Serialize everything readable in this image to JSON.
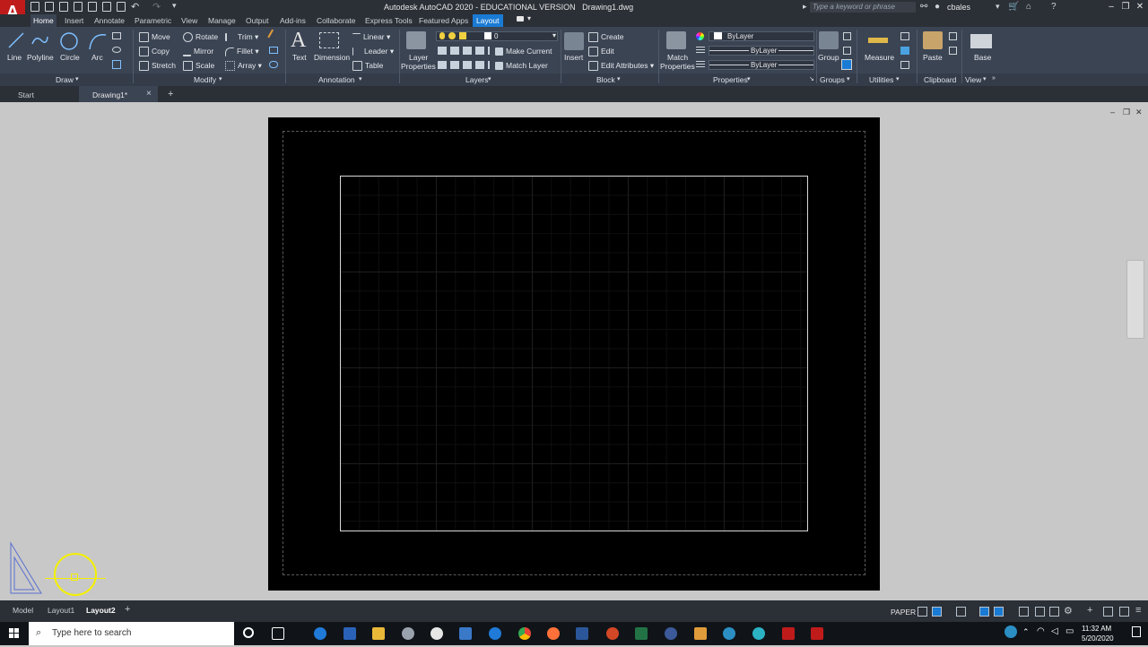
{
  "title_bar": {
    "app_title": "Autodesk AutoCAD 2020 - EDUCATIONAL VERSION",
    "file_name": "Drawing1.dwg",
    "search_placeholder": "Type a keyword or phrase",
    "user": "cbales",
    "logo_letter": "A"
  },
  "ribbon_tabs": [
    "Home",
    "Insert",
    "Annotate",
    "Parametric",
    "View",
    "Manage",
    "Output",
    "Add-ins",
    "Collaborate",
    "Express Tools",
    "Featured Apps",
    "Layout"
  ],
  "ribbon": {
    "draw": {
      "label": "Draw",
      "tools": [
        "Line",
        "Polyline",
        "Circle",
        "Arc"
      ]
    },
    "modify": {
      "label": "Modify",
      "tools": [
        "Move",
        "Rotate",
        "Trim",
        "Copy",
        "Mirror",
        "Fillet",
        "Stretch",
        "Scale",
        "Array"
      ]
    },
    "annotation": {
      "label": "Annotation",
      "tools": [
        "Text",
        "Dimension",
        "Linear",
        "Leader",
        "Table"
      ]
    },
    "layers": {
      "label": "Layers",
      "layer_properties_1": "Layer",
      "layer_properties_2": "Properties",
      "current_layer": "0",
      "make_current": "Make Current",
      "match_layer": "Match Layer"
    },
    "block": {
      "label": "Block",
      "insert": "Insert",
      "create": "Create",
      "edit": "Edit",
      "edit_attributes": "Edit Attributes"
    },
    "properties": {
      "label": "Properties",
      "match_1": "Match",
      "match_2": "Properties",
      "color": "ByLayer",
      "linetype": "ByLayer",
      "lineweight": "ByLayer"
    },
    "groups": {
      "label": "Groups",
      "group": "Group"
    },
    "utilities": {
      "label": "Utilities",
      "measure": "Measure"
    },
    "clipboard": {
      "label": "Clipboard",
      "paste": "Paste"
    },
    "view": {
      "label": "View",
      "base": "Base"
    }
  },
  "file_tabs": {
    "start": "Start",
    "drawing": "Drawing1*",
    "close": "×",
    "add": "+"
  },
  "layout_tabs": {
    "tabs": [
      "Model",
      "Layout1",
      "Layout2"
    ],
    "active": "Layout2",
    "add": "+"
  },
  "status": {
    "space": "PAPER"
  },
  "taskbar": {
    "search_placeholder": "Type here to search",
    "time": "11:32 AM",
    "date": "5/20/2020"
  },
  "colors": {
    "ribbon_bg": "#3b4453",
    "title_bg": "#2b2f36",
    "canvas_bg": "#c8c8c8",
    "paper": "#000000",
    "cursor": "#f4f000",
    "accent": "#1a7bd4"
  }
}
